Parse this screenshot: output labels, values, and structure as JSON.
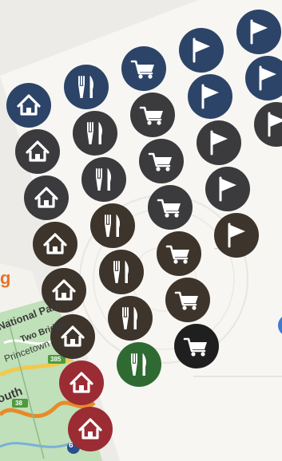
{
  "palette": {
    "navy": "#2c4468",
    "charcoal": "#3b3b3d",
    "umber": "#3d342b",
    "red": "#9b2c33",
    "green": "#2f6a32",
    "black": "#1f1f1f",
    "orange_text": "#e8742a",
    "sheet": "#f7f6f2"
  },
  "icons": [
    {
      "row": 1,
      "col": 1,
      "icon": "home-icon",
      "color": "navy"
    },
    {
      "row": 1,
      "col": 2,
      "icon": "fork-knife-icon",
      "color": "navy"
    },
    {
      "row": 1,
      "col": 3,
      "icon": "cart-icon",
      "color": "navy"
    },
    {
      "row": 1,
      "col": 4,
      "icon": "flag-icon",
      "color": "navy"
    },
    {
      "row": 1,
      "col": 5,
      "icon": "flag-icon",
      "color": "navy"
    },
    {
      "row": 2,
      "col": 1,
      "icon": "home-icon",
      "color": "charcoal"
    },
    {
      "row": 2,
      "col": 2,
      "icon": "fork-knife-icon",
      "color": "charcoal"
    },
    {
      "row": 2,
      "col": 3,
      "icon": "cart-icon",
      "color": "charcoal"
    },
    {
      "row": 2,
      "col": 4,
      "icon": "flag-icon",
      "color": "navy"
    },
    {
      "row": 2,
      "col": 5,
      "icon": "flag-icon",
      "color": "navy"
    },
    {
      "row": 3,
      "col": 1,
      "icon": "home-icon",
      "color": "charcoal"
    },
    {
      "row": 3,
      "col": 2,
      "icon": "fork-knife-icon",
      "color": "charcoal"
    },
    {
      "row": 3,
      "col": 3,
      "icon": "cart-icon",
      "color": "charcoal"
    },
    {
      "row": 3,
      "col": 4,
      "icon": "flag-icon",
      "color": "charcoal"
    },
    {
      "row": 3,
      "col": 5,
      "icon": "flag-icon",
      "color": "charcoal"
    },
    {
      "row": 4,
      "col": 1,
      "icon": "home-icon",
      "color": "umber"
    },
    {
      "row": 4,
      "col": 2,
      "icon": "fork-knife-icon",
      "color": "umber"
    },
    {
      "row": 4,
      "col": 3,
      "icon": "cart-icon",
      "color": "charcoal"
    },
    {
      "row": 4,
      "col": 4,
      "icon": "flag-icon",
      "color": "charcoal"
    },
    {
      "row": 5,
      "col": 1,
      "icon": "home-icon",
      "color": "umber"
    },
    {
      "row": 5,
      "col": 2,
      "icon": "fork-knife-icon",
      "color": "umber"
    },
    {
      "row": 5,
      "col": 3,
      "icon": "cart-icon",
      "color": "umber"
    },
    {
      "row": 5,
      "col": 4,
      "icon": "flag-icon",
      "color": "umber"
    },
    {
      "row": 6,
      "col": 1,
      "icon": "home-icon",
      "color": "umber"
    },
    {
      "row": 6,
      "col": 2,
      "icon": "fork-knife-icon",
      "color": "umber"
    },
    {
      "row": 6,
      "col": 3,
      "icon": "cart-icon",
      "color": "umber"
    },
    {
      "row": 7,
      "col": 1,
      "icon": "home-icon",
      "color": "red"
    },
    {
      "row": 7,
      "col": 2,
      "icon": "fork-knife-icon",
      "color": "green"
    },
    {
      "row": 7,
      "col": 3,
      "icon": "cart-icon",
      "color": "black"
    },
    {
      "row": 8,
      "col": 1,
      "icon": "home-icon",
      "color": "red"
    }
  ],
  "map": {
    "labels": [
      {
        "id": "park",
        "text": "National Park"
      },
      {
        "id": "bridges",
        "text": "Two Bridges"
      },
      {
        "id": "town1",
        "text": "Princetown"
      },
      {
        "id": "south",
        "text": "outh"
      }
    ],
    "road_numbers": [
      "6",
      "385",
      "38"
    ]
  },
  "heading_fragment": "g"
}
